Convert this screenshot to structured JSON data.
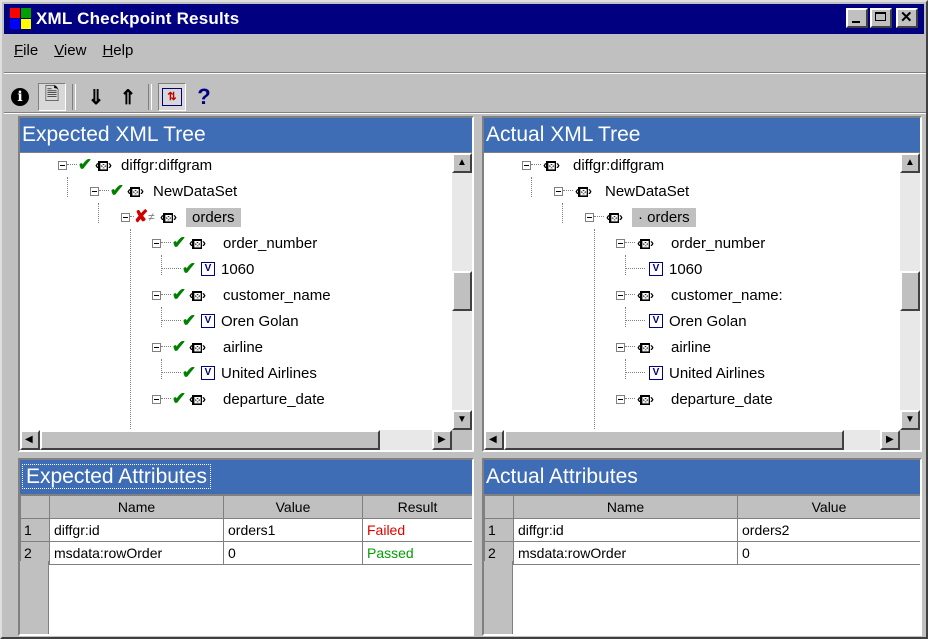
{
  "window": {
    "title": "XML Checkpoint Results"
  },
  "menu": [
    {
      "label": "File",
      "key": "F",
      "rest": "ile"
    },
    {
      "label": "View",
      "key": "V",
      "rest": "iew"
    },
    {
      "label": "Help",
      "key": "H",
      "rest": "elp"
    }
  ],
  "toolbar": {
    "buttons": [
      "info-icon",
      "properties-icon",
      "next-mismatch-icon",
      "previous-mismatch-icon",
      "synchronize-icon",
      "help-icon"
    ]
  },
  "expected_tree": {
    "title": "Expected XML Tree",
    "nodes": [
      {
        "label": "diffgr:diffgram"
      },
      {
        "label": "NewDataSet"
      },
      {
        "label": "orders"
      },
      {
        "label": "order_number"
      },
      {
        "label": "1060"
      },
      {
        "label": "customer_name"
      },
      {
        "label": "Oren Golan"
      },
      {
        "label": "airline"
      },
      {
        "label": "United Airlines"
      },
      {
        "label": "departure_date"
      }
    ]
  },
  "actual_tree": {
    "title": "Actual XML Tree",
    "nodes": [
      {
        "label": "diffgr:diffgram"
      },
      {
        "label": "NewDataSet"
      },
      {
        "label": "· orders"
      },
      {
        "label": "order_number"
      },
      {
        "label": "1060"
      },
      {
        "label": "customer_name:"
      },
      {
        "label": "Oren Golan"
      },
      {
        "label": "airline"
      },
      {
        "label": "United Airlines"
      },
      {
        "label": "departure_date"
      }
    ]
  },
  "expected_attributes": {
    "title": "Expected Attributes",
    "columns": [
      "Name",
      "Value",
      "Result"
    ],
    "rows": [
      {
        "num": "1",
        "name": "diffgr:id",
        "value": "orders1",
        "result": "Failed"
      },
      {
        "num": "2",
        "name": "msdata:rowOrder",
        "value": "0",
        "result": "Passed"
      }
    ]
  },
  "actual_attributes": {
    "title": "Actual Attributes",
    "columns": [
      "Name",
      "Value"
    ],
    "rows": [
      {
        "num": "1",
        "name": "diffgr:id",
        "value": "orders2"
      },
      {
        "num": "2",
        "name": "msdata:rowOrder",
        "value": "0"
      }
    ]
  },
  "colors": {
    "title_bar": "#000080",
    "pane_header": "#3e6db5",
    "failed": "#e00000",
    "passed": "#00a000",
    "check": "#008000"
  }
}
